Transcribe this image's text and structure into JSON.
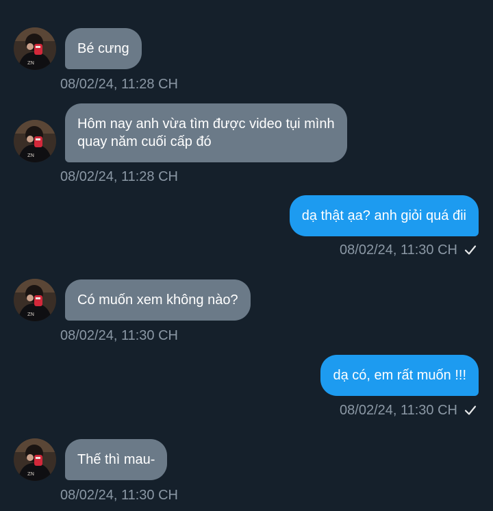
{
  "colors": {
    "background": "#15202b",
    "incoming_bubble": "#6b7a88",
    "outgoing_bubble": "#1d9bf0",
    "timestamp": "#8b98a5",
    "text": "#ffffff"
  },
  "messages": [
    {
      "direction": "incoming",
      "lines": [
        "Bé cưng"
      ],
      "time": "08/02/24, 11:28 CH"
    },
    {
      "direction": "incoming",
      "lines": [
        "Hôm nay anh vừa tìm được video tụi mình",
        "quay năm cuối cấp đó"
      ],
      "time": "08/02/24, 11:28 CH"
    },
    {
      "direction": "outgoing",
      "lines": [
        "dạ thật ạa? anh giỏi quá đii"
      ],
      "time": "08/02/24, 11:30 CH",
      "status_icon": "checkmark-icon"
    },
    {
      "direction": "incoming",
      "lines": [
        "Có muốn xem không nào?"
      ],
      "time": "08/02/24, 11:30 CH"
    },
    {
      "direction": "outgoing",
      "lines": [
        "dạ có, em rất muốn !!!"
      ],
      "time": "08/02/24, 11:30 CH",
      "status_icon": "checkmark-icon"
    },
    {
      "direction": "incoming",
      "lines": [
        "Thế thì mau-"
      ],
      "time": "08/02/24, 11:30 CH"
    }
  ]
}
